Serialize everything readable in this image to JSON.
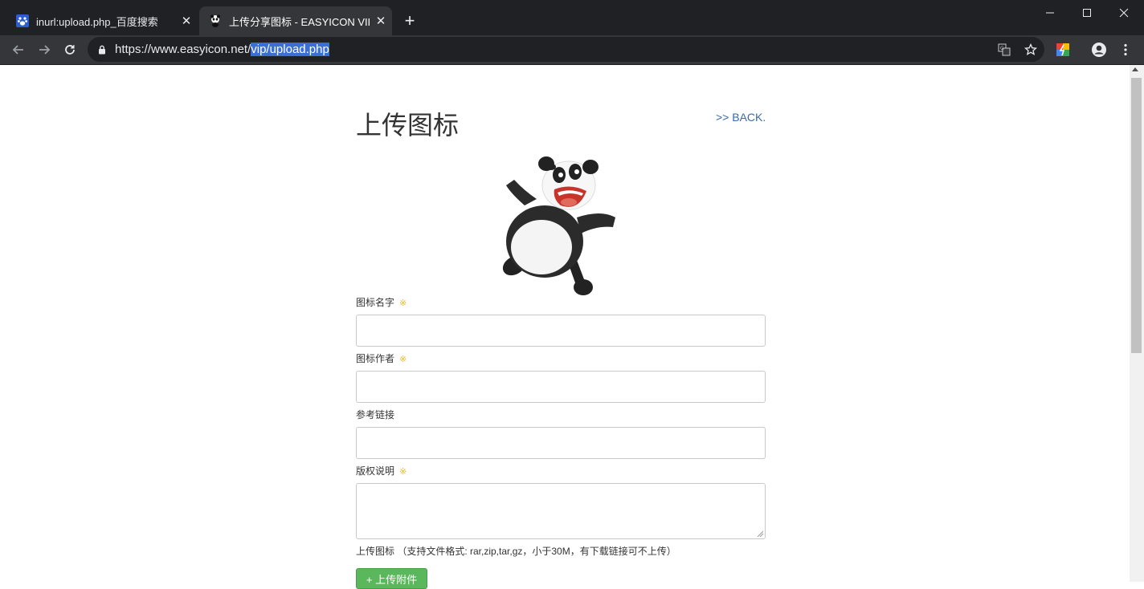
{
  "browser": {
    "tabs": [
      {
        "title": "inurl:upload.php_百度搜索",
        "favicon": "baidu-paw-icon"
      },
      {
        "title": "上传分享图标 - EASYICON VIP",
        "favicon": "panda-icon"
      }
    ],
    "url_prefix": "https://www.easyicon.net/",
    "url_selected": "vip/upload.php"
  },
  "page": {
    "title": "上传图标",
    "back_link": ">> BACK.",
    "required_mark": "※",
    "fields": {
      "icon_name_label": "图标名字",
      "author_label": "图标作者",
      "reference_label": "参考链接",
      "copyright_label": "版权说明"
    },
    "upload_hint": "上传图标 （支持文件格式: rar,zip,tar,gz，小于30M，有下载链接可不上传）",
    "upload_button": "+ 上传附件"
  },
  "colors": {
    "accent_link": "#3a6aa8",
    "upload_button": "#5bb75b",
    "required_mark": "#e8b82a"
  }
}
